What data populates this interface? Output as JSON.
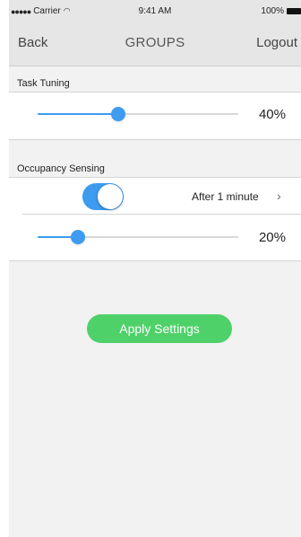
{
  "status_bar": {
    "carrier": "Carrier",
    "time": "9:41 AM",
    "battery": "100%"
  },
  "nav": {
    "back_label": "Back",
    "title": "GROUPS",
    "logout_label": "Logout"
  },
  "task_tuning": {
    "header": "Task Tuning",
    "value": 0.4,
    "value_label": "40%"
  },
  "occupancy_sensing": {
    "header": "Occupancy Sensing",
    "enabled": true,
    "delay_label": "After 1 minute",
    "value": 0.2,
    "value_label": "20%"
  },
  "apply_button": {
    "label": "Apply Settings"
  },
  "colors": {
    "accent": "#3d9bf0",
    "apply_button": "#4fd16a",
    "nav_background": "#e6e6e6",
    "screen_background": "#f2f2f2"
  }
}
